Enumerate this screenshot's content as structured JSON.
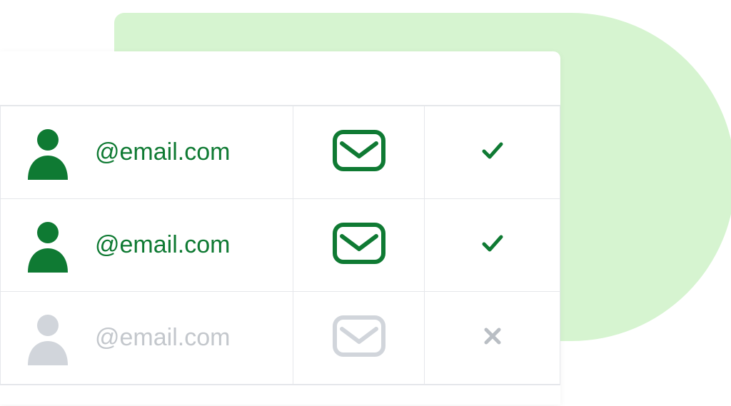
{
  "colors": {
    "accent": "#0f7a33",
    "blob": "#d6f4d0",
    "muted": "#d1d5db",
    "border": "#e5e7eb"
  },
  "rows": [
    {
      "email": "@email.com",
      "status": "valid",
      "status_icon": "check-icon",
      "enabled": true
    },
    {
      "email": "@email.com",
      "status": "valid",
      "status_icon": "check-icon",
      "enabled": true
    },
    {
      "email": "@email.com",
      "status": "invalid",
      "status_icon": "cross-icon",
      "enabled": false
    }
  ]
}
